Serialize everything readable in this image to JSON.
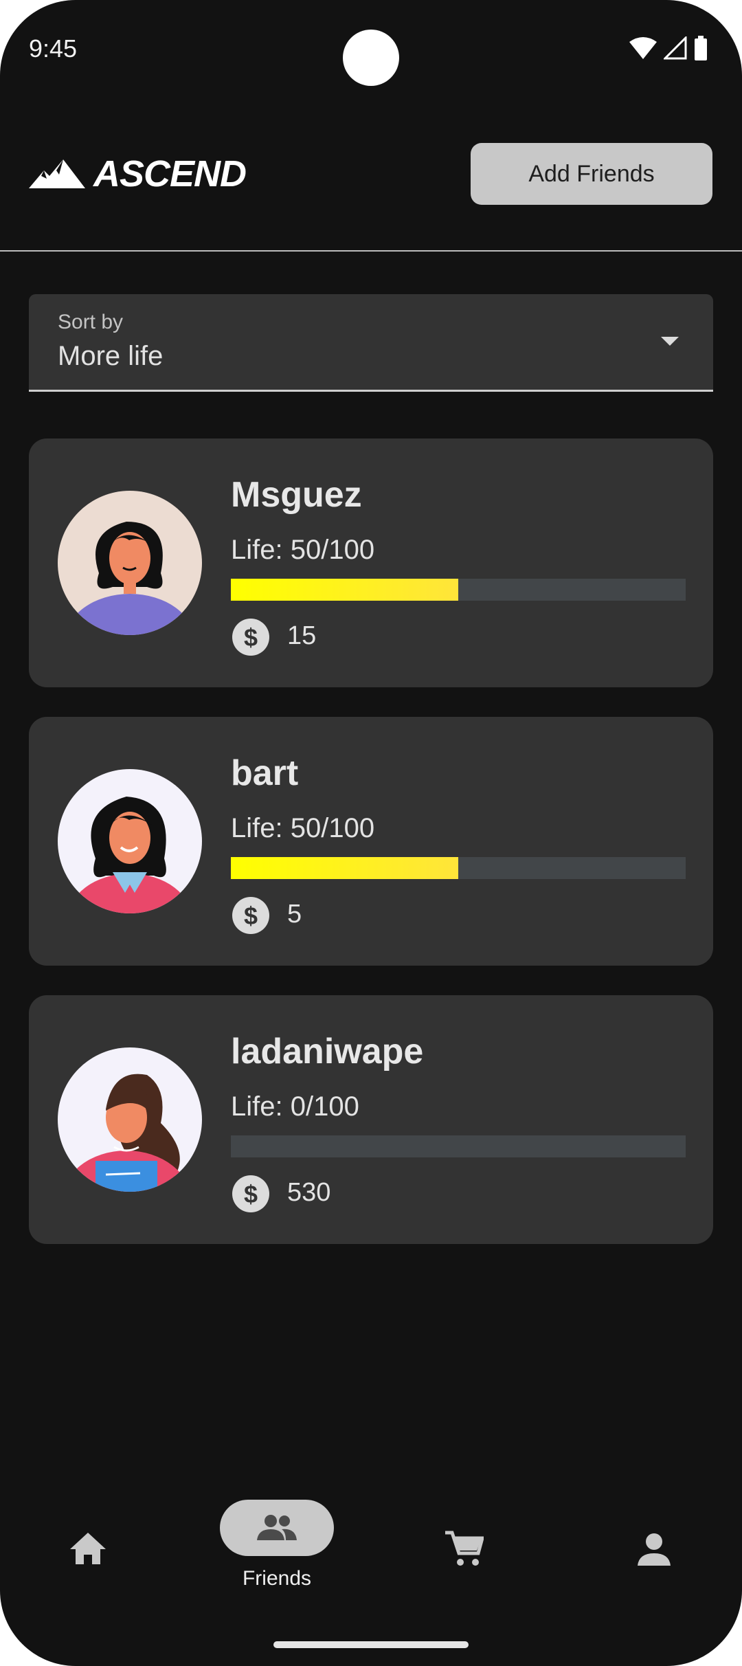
{
  "status_bar": {
    "time": "9:45"
  },
  "header": {
    "app_name": "ASCEND",
    "add_friends_label": "Add Friends"
  },
  "sort": {
    "label": "Sort by",
    "value": "More life"
  },
  "friends": [
    {
      "name": "Msguez",
      "life_text": "Life: 50/100",
      "life_fraction": 0.5,
      "coins": "15"
    },
    {
      "name": "bart",
      "life_text": "Life: 50/100",
      "life_fraction": 0.5,
      "coins": "5"
    },
    {
      "name": "ladaniwape",
      "life_text": "Life: 0/100",
      "life_fraction": 0.0,
      "coins": "530"
    }
  ],
  "bottom_nav": {
    "items": [
      {
        "icon": "home-icon"
      },
      {
        "icon": "people-icon",
        "label": "Friends",
        "active": true
      },
      {
        "icon": "shopping-cart-icon"
      },
      {
        "icon": "person-icon"
      }
    ]
  },
  "colors": {
    "background": "#121212",
    "card": "#333333",
    "life_bar": "#ffff00",
    "life_track": "#424649",
    "button": "#c8c8c8"
  }
}
